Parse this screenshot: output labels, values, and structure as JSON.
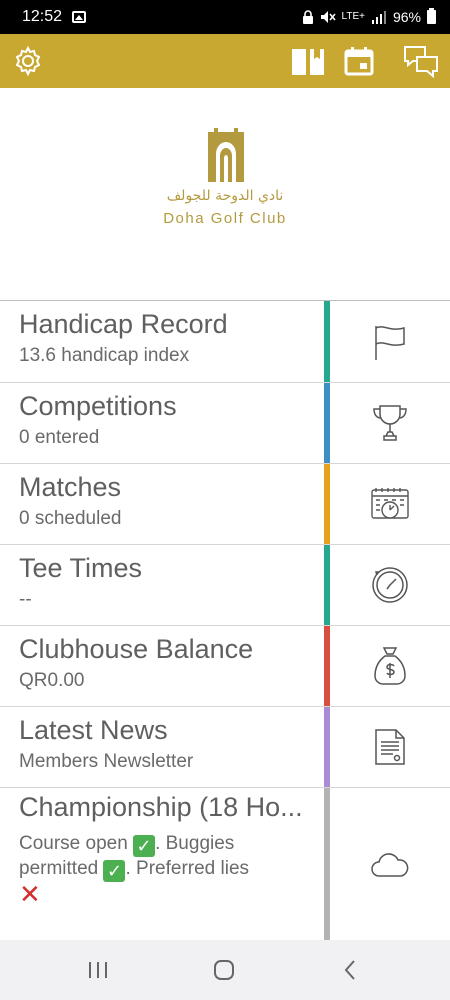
{
  "status_bar": {
    "time": "12:52",
    "network": "LTE+",
    "battery": "96%"
  },
  "toolbar": {
    "accent_color": "#c9a832",
    "left_icon": "gear-icon",
    "right_icons": [
      "book-icon",
      "calendar-icon",
      "chat-icon"
    ]
  },
  "logo": {
    "arabic_text": "نادي الدوحة للجولف",
    "english_text": "Doha Golf Club"
  },
  "items": [
    {
      "title": "Handicap Record",
      "subtitle": "13.6 handicap index",
      "color": "#26a88e",
      "icon": "flag-icon"
    },
    {
      "title": "Competitions",
      "subtitle": "0 entered",
      "color": "#3e8fc4",
      "icon": "trophy-icon"
    },
    {
      "title": "Matches",
      "subtitle": "0 scheduled",
      "color": "#e6a21e",
      "icon": "calendar-clock-icon"
    },
    {
      "title": "Tee Times",
      "subtitle": "--",
      "color": "#26a88e",
      "icon": "clock-icon"
    },
    {
      "title": "Clubhouse Balance",
      "subtitle": "QR0.00",
      "color": "#d84e3f",
      "icon": "money-bag-icon"
    },
    {
      "title": "Latest News",
      "subtitle": "Members Newsletter",
      "color": "#a98bd6",
      "icon": "document-icon"
    },
    {
      "title": "Championship (18 Ho...",
      "subtitle_part1": "Course open ",
      "subtitle_part2": ". Buggies permitted ",
      "subtitle_part3": ". Preferred lies ",
      "color": "#b3b3b3",
      "icon": "cloud-icon"
    }
  ]
}
